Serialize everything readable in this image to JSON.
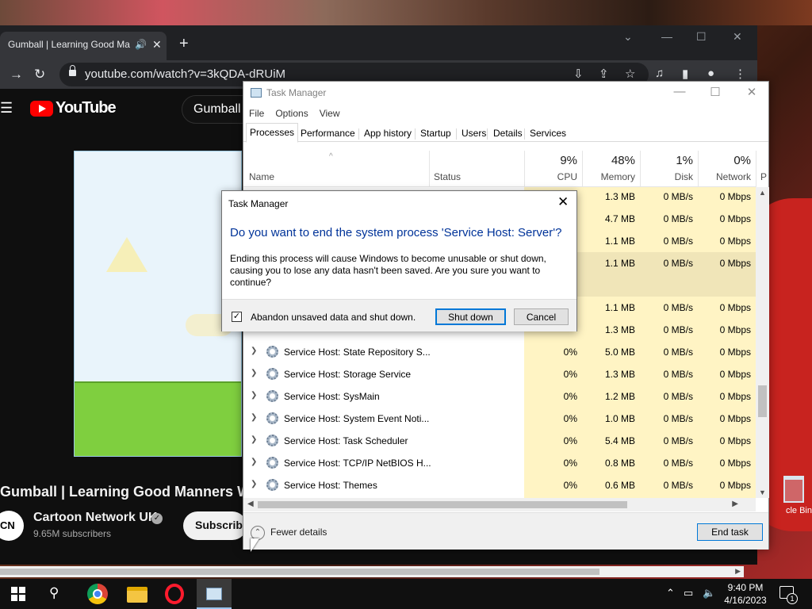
{
  "browser": {
    "tab_title": "Gumball | Learning Good Ma",
    "new_tab": "+",
    "url": "youtube.com/watch?v=3kQDA-dRUiM",
    "controls": {
      "minimize": "⌄",
      "min": "—",
      "max": "☐",
      "close": "✕"
    }
  },
  "youtube": {
    "logo_text": "YouTube",
    "search_value": "Gumball",
    "video_title": "Gumball | Learning Good Manners Wi",
    "channel_avatar": "CN",
    "channel_name": "Cartoon Network UK",
    "verified": "✓",
    "subscribers": "9.65M subscribers",
    "subscribe_label": "Subscribe"
  },
  "task_manager": {
    "title": "Task Manager",
    "menu": [
      "File",
      "Options",
      "View"
    ],
    "tabs": [
      "Processes",
      "Performance",
      "App history",
      "Startup",
      "Users",
      "Details",
      "Services"
    ],
    "active_tab": "Processes",
    "columns": {
      "name": "Name",
      "status": "Status",
      "cpu": {
        "pct": "9%",
        "label": "CPU"
      },
      "memory": {
        "pct": "48%",
        "label": "Memory"
      },
      "disk": {
        "pct": "1%",
        "label": "Disk"
      },
      "network": {
        "pct": "0%",
        "label": "Network"
      },
      "power": "P"
    },
    "rows": [
      {
        "name": "",
        "cpu": "",
        "memory": "1.3 MB",
        "disk": "0 MB/s",
        "network": "0 Mbps"
      },
      {
        "name": "",
        "cpu": "",
        "memory": "4.7 MB",
        "disk": "0 MB/s",
        "network": "0 Mbps"
      },
      {
        "name": "",
        "cpu": "",
        "memory": "1.1 MB",
        "disk": "0 MB/s",
        "network": "0 Mbps"
      },
      {
        "name": "",
        "cpu": "",
        "memory": "1.1 MB",
        "disk": "0 MB/s",
        "network": "0 Mbps"
      },
      {
        "name": "",
        "cpu": "",
        "memory": "",
        "disk": "",
        "network": ""
      },
      {
        "name": "",
        "cpu": "",
        "memory": "1.1 MB",
        "disk": "0 MB/s",
        "network": "0 Mbps"
      },
      {
        "name": "",
        "cpu": "",
        "memory": "1.3 MB",
        "disk": "0 MB/s",
        "network": "0 Mbps"
      },
      {
        "name": "Service Host: State Repository S...",
        "cpu": "0%",
        "memory": "5.0 MB",
        "disk": "0 MB/s",
        "network": "0 Mbps"
      },
      {
        "name": "Service Host: Storage Service",
        "cpu": "0%",
        "memory": "1.3 MB",
        "disk": "0 MB/s",
        "network": "0 Mbps"
      },
      {
        "name": "Service Host: SysMain",
        "cpu": "0%",
        "memory": "1.2 MB",
        "disk": "0 MB/s",
        "network": "0 Mbps"
      },
      {
        "name": "Service Host: System Event Noti...",
        "cpu": "0%",
        "memory": "1.0 MB",
        "disk": "0 MB/s",
        "network": "0 Mbps"
      },
      {
        "name": "Service Host: Task Scheduler",
        "cpu": "0%",
        "memory": "5.4 MB",
        "disk": "0 MB/s",
        "network": "0 Mbps"
      },
      {
        "name": "Service Host: TCP/IP NetBIOS H...",
        "cpu": "0%",
        "memory": "0.8 MB",
        "disk": "0 MB/s",
        "network": "0 Mbps"
      },
      {
        "name": "Service Host: Themes",
        "cpu": "0%",
        "memory": "0.6 MB",
        "disk": "0 MB/s",
        "network": "0 Mbps"
      }
    ],
    "fewer_details": "Fewer details",
    "end_task": "End task"
  },
  "dialog": {
    "title": "Task Manager",
    "question": "Do you want to end the system process 'Service Host: Server'?",
    "body": "Ending this process will cause Windows to become unusable or shut down, causing you to lose any data hasn't been saved. Are you sure you want to continue?",
    "checkbox_label": "Abandon unsaved data and shut down.",
    "checkbox_checked": "✓",
    "shutdown_label": "Shut down",
    "cancel_label": "Cancel",
    "close": "✕"
  },
  "desktop": {
    "recycle_bin_label": "cle Bin"
  },
  "taskbar": {
    "time": "9:40 PM",
    "date": "4/16/2023",
    "notification_count": "1"
  },
  "colors": {
    "accent": "#0078d7",
    "dialog_heading": "#003399",
    "column_highlight": "#fff4c4",
    "youtube_red": "#ff0000"
  }
}
